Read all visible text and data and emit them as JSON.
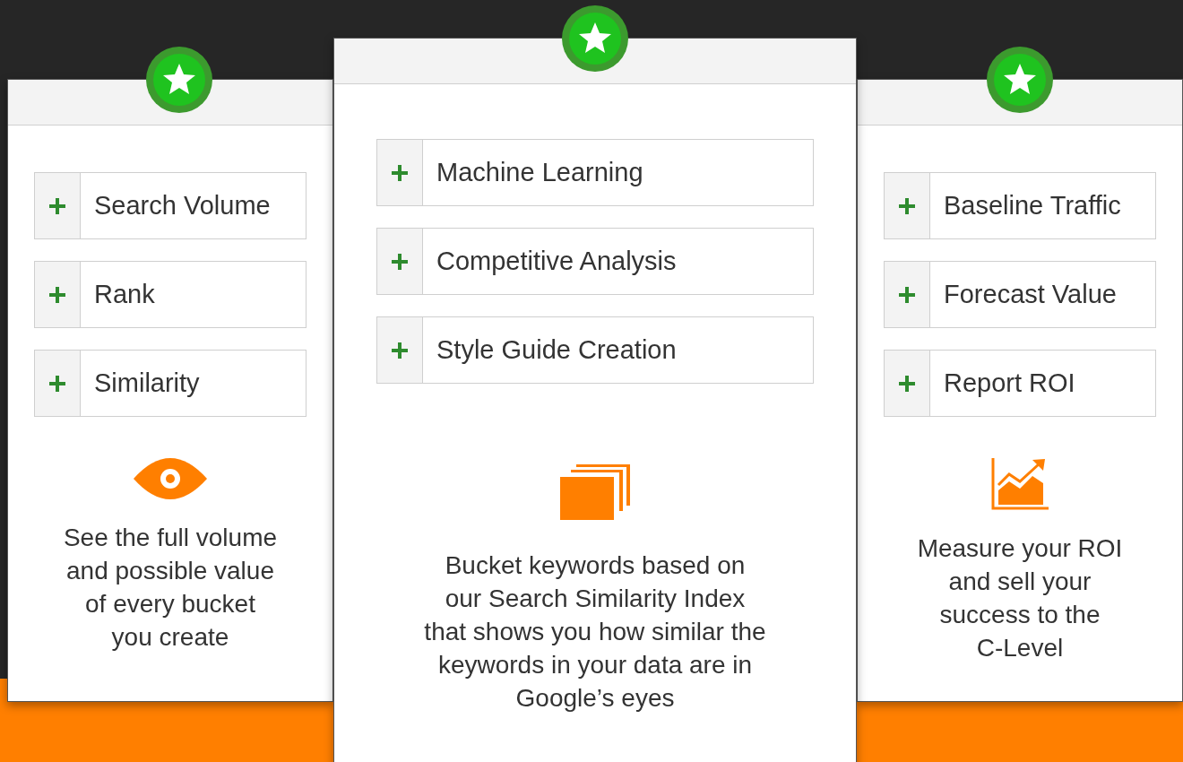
{
  "cards": [
    {
      "kind": "side",
      "features": [
        "Search Volume",
        "Rank",
        "Similarity"
      ],
      "icon": {
        "kind": "eye"
      },
      "description": "See the full volume\nand possible value\nof every bucket\nyou create"
    },
    {
      "kind": "center",
      "features": [
        "Machine Learning",
        "Competitive Analysis",
        "Style Guide Creation"
      ],
      "icon": {
        "kind": "stack"
      },
      "description": "Bucket keywords based on\nour Search Similarity Index\nthat shows you how similar the\nkeywords in your data are in\nGoogle’s eyes"
    },
    {
      "kind": "side",
      "features": [
        "Baseline Traffic",
        "Forecast Value",
        "Report ROI"
      ],
      "icon": {
        "kind": "chart"
      },
      "description": "Measure your ROI\nand sell your\nsuccess to the\nC-Level"
    }
  ]
}
